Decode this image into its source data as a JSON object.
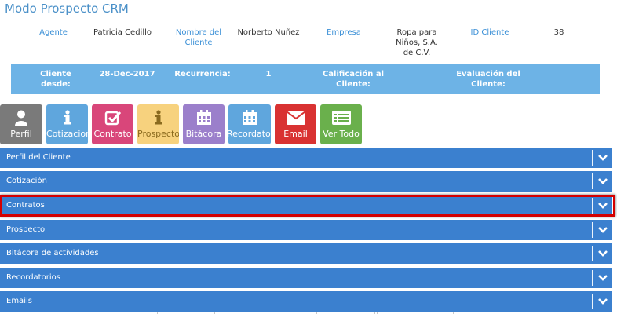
{
  "header": {
    "title": "Modo Prospecto CRM"
  },
  "client_info": {
    "agent_label": "Agente",
    "agent_value": "Patricia Cedillo",
    "client_name_label": "Nombre del Cliente",
    "client_name_value": "Norberto Nuñez",
    "company_label": "Empresa",
    "company_value": "Ropa para Niños, S.A. de C.V.",
    "client_id_label": "ID Cliente",
    "client_id_value": "38"
  },
  "summary": {
    "since_label": "Cliente desde:",
    "since_value": "28-Dec-2017",
    "recurrence_label": "Recurrencia:",
    "recurrence_value": "1",
    "rating_label": "Calificación al Cliente:",
    "evaluation_label": "Evaluación del Cliente:"
  },
  "toolbar": {
    "buttons": [
      {
        "label": "Perfil",
        "icon": "user-icon",
        "color": "#7a7a7a"
      },
      {
        "label": "Cotizacion",
        "icon": "info-icon",
        "color": "#5fa6dd"
      },
      {
        "label": "Contrato",
        "icon": "checkbox-icon",
        "color": "#d9467a"
      },
      {
        "label": "Prospecto",
        "icon": "info-icon",
        "color": "#f7d27e",
        "text_color": "#8a6a1e"
      },
      {
        "label": "Bitácora",
        "icon": "calendar-icon",
        "color": "#9b7fcb"
      },
      {
        "label": "Recordatorios",
        "icon": "calendar-icon",
        "color": "#5fa6dd"
      },
      {
        "label": "Email",
        "icon": "envelope-icon",
        "color": "#d93232"
      },
      {
        "label": "Ver Todo",
        "icon": "list-icon",
        "color": "#6ab04c"
      }
    ]
  },
  "sections": [
    {
      "label": "Perfil del Cliente"
    },
    {
      "label": "Cotización"
    },
    {
      "label": "Contratos"
    },
    {
      "label": "Prospecto"
    },
    {
      "label": "Bitácora de actividades"
    },
    {
      "label": "Recordatorios"
    },
    {
      "label": "Emails"
    }
  ],
  "colors": {
    "accent": "#3b80cf",
    "summary_bar": "#6db3e6",
    "highlight": "#d40000"
  }
}
